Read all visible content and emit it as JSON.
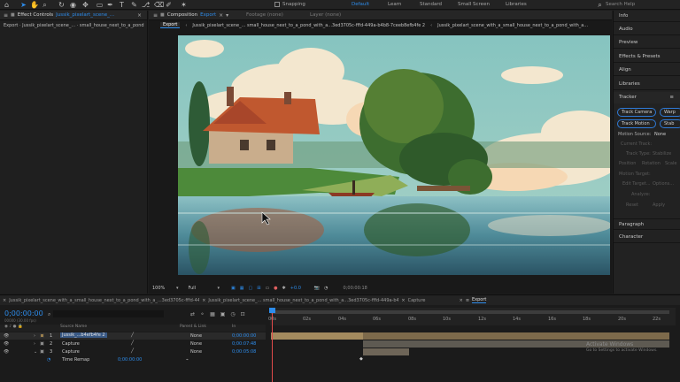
{
  "toolbar": {
    "snapping_label": "Snapping",
    "workspaces": [
      "Default",
      "Learn",
      "Standard",
      "Small Screen",
      "Libraries"
    ],
    "active_workspace": "Default",
    "search_placeholder": "Search Help"
  },
  "left_panel": {
    "tab_label": "Effect Controls",
    "tab_file": "Jussik_pixelart_scene_...",
    "subtitle": "Export · Jussik_pixelart_scene_... · small_house_next_to_a_pond"
  },
  "comp_panel": {
    "tab_label": "Composition",
    "tab_active": "Export",
    "footage_tab": "Footage (none)",
    "layer_tab": "Layer (none)",
    "breadcrumbs": [
      "Export",
      "Jussik_pixelart_scene_... small_house_next_to_a_pond_with_a...3ed3705c-fffd-449a-b4b8-7ceeb8efb4fe 2",
      "Jussik_pixelart_scene_with_a_small_house_next_to_a_pond_with_a..."
    ],
    "zoom": "100%",
    "resolution": "Full",
    "exposure": "+0.0",
    "timecode": "0;00:00:18"
  },
  "right_panel": {
    "items": [
      "Info",
      "Audio",
      "Preview",
      "Effects & Presets",
      "Align",
      "Libraries"
    ],
    "tracker_label": "Tracker",
    "track_buttons": [
      "Track Camera",
      "Warp",
      "Track Motion",
      "Stab"
    ],
    "motion_source_label": "Motion Source:",
    "motion_source_value": "None",
    "dim_labels": [
      "Current Track:",
      "Track Type:",
      "Stabilize",
      "Position",
      "Rotation",
      "Scale",
      "Motion Target:",
      "Edit Target...",
      "Options...",
      "Analyze:",
      "Reset",
      "Apply"
    ],
    "lower_items": [
      "Paragraph",
      "Character"
    ]
  },
  "timeline": {
    "tabs": [
      "Jussik_pixelart_scene_with_a_small_house_next_to_a_pond_with_a_...3ed3705c-fffd-449a-b4b8-7ceeb8efb4fe 2",
      "Jussik_pixelart_scene_... small_house_next_to_a_pond_with_a...3ed3705c-fffd-449a-b4b8-7ceeb8efb4fe 2",
      "Capture",
      "Export"
    ],
    "current_time": "0;00:00:00",
    "fps": "00000 (30.00 fps)",
    "columns": {
      "source_name": "Source Name",
      "parent": "Parent & Link",
      "in": "In"
    },
    "layers": [
      {
        "num": "1",
        "name": "Jussik_...b4efb4fe 2",
        "parent": "None",
        "in": "0;00:00:00"
      },
      {
        "num": "2",
        "name": "Capture",
        "parent": "None",
        "in": "0;00:07:48"
      },
      {
        "num": "3",
        "name": "Capture",
        "parent": "None",
        "in": "0;00:05:08"
      }
    ],
    "sub_property": "Time Remap",
    "sub_value": "0;00:00:00",
    "ruler": [
      "00s",
      "02s",
      "04s",
      "06s",
      "08s",
      "10s",
      "12s",
      "14s",
      "16s",
      "18s",
      "20s",
      "22s"
    ],
    "watermark_title": "Activate Windows",
    "watermark_sub": "Go to Settings to activate Windows."
  },
  "colors": {
    "accent": "#2d8ceb",
    "panel": "#1f1f1f",
    "layer_bar": "#8f7a56"
  }
}
